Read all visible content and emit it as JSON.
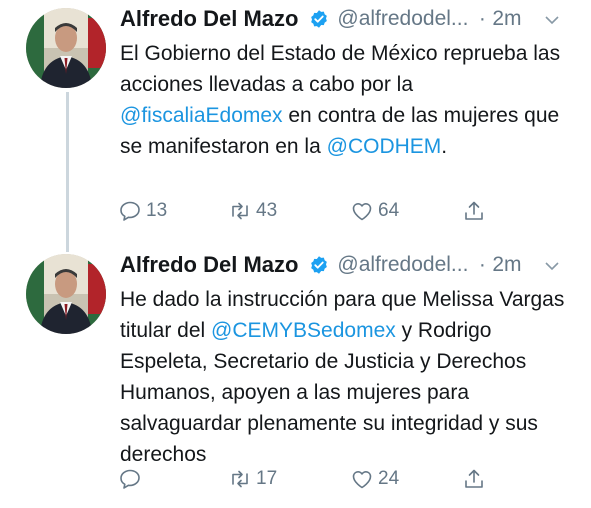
{
  "colors": {
    "text": "#14171a",
    "muted": "#657786",
    "link": "#1b95e0",
    "verified": "#1da1f2",
    "thread_line": "#ccd6dd"
  },
  "tweets": [
    {
      "author_name": "Alfredo Del Mazo",
      "author_handle": "@alfredodel...",
      "dot": "·",
      "time": "2m",
      "text_parts": [
        {
          "text": "El Gobierno del Estado de México reprueba las acciones llevadas a cabo por la ",
          "mention": false
        },
        {
          "text": "@fiscaliaEdomex",
          "mention": true
        },
        {
          "text": " en contra de las mujeres que se manifestaron en la ",
          "mention": false
        },
        {
          "text": "@CODHEM",
          "mention": true
        },
        {
          "text": ".",
          "mention": false
        }
      ],
      "reply_count": "13",
      "retweet_count": "43",
      "like_count": "64",
      "icons": [
        "verified-badge-icon",
        "chevron-down-icon",
        "reply-icon",
        "retweet-icon",
        "heart-icon",
        "share-icon"
      ]
    },
    {
      "author_name": "Alfredo Del Mazo",
      "author_handle": "@alfredodel...",
      "dot": "·",
      "time": "2m",
      "text_parts": [
        {
          "text": "He dado la instrucción para que Melissa Vargas titular del ",
          "mention": false
        },
        {
          "text": "@CEMYBSedomex",
          "mention": true
        },
        {
          "text": " y Rodrigo Espeleta, Secretario de Justicia y Derechos Humanos, apoyen a las mujeres para salvaguardar plenamente su integridad y sus derechos",
          "mention": false
        }
      ],
      "reply_count": "",
      "retweet_count": "17",
      "like_count": "24",
      "icons": [
        "verified-badge-icon",
        "chevron-down-icon",
        "reply-icon",
        "retweet-icon",
        "heart-icon",
        "share-icon"
      ]
    }
  ]
}
